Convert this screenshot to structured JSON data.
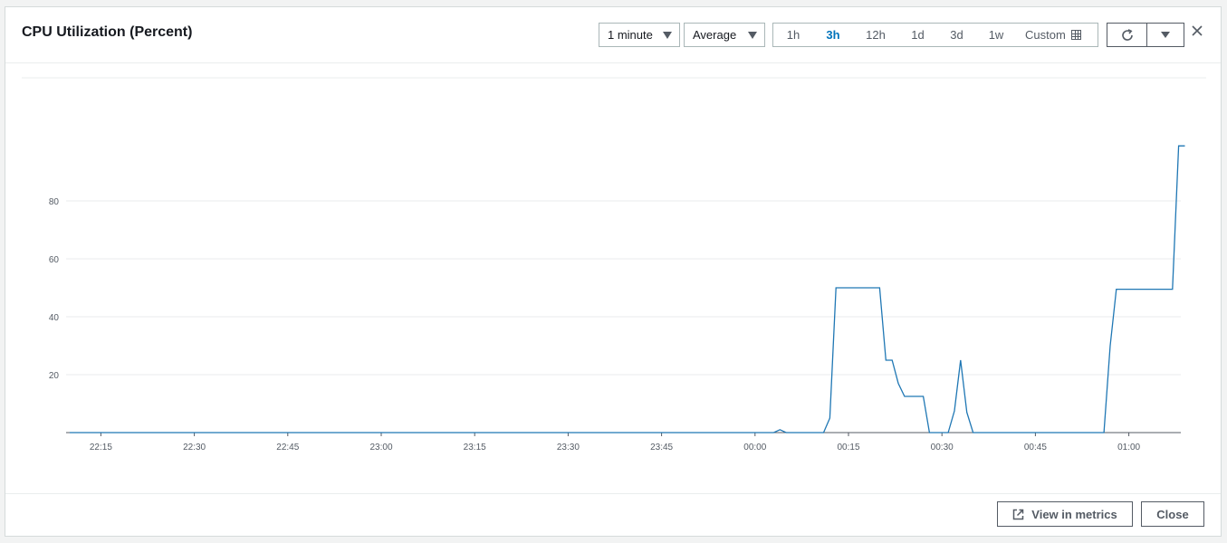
{
  "header": {
    "title": "CPU Utilization (Percent)",
    "period_select": "1 minute",
    "statistic_select": "Average",
    "time_ranges": [
      {
        "label": "1h",
        "active": false
      },
      {
        "label": "3h",
        "active": true
      },
      {
        "label": "12h",
        "active": false
      },
      {
        "label": "1d",
        "active": false
      },
      {
        "label": "3d",
        "active": false
      },
      {
        "label": "1w",
        "active": false
      }
    ],
    "custom_label": "Custom"
  },
  "footer": {
    "view_in_metrics": "View in metrics",
    "close": "Close"
  },
  "colors": {
    "series": "#1f77b4",
    "active_range": "#0073bb"
  },
  "icons": [
    "calendar-icon",
    "refresh-icon",
    "chevron-down-icon",
    "close-icon",
    "external-link-icon"
  ],
  "chart_data": {
    "type": "line",
    "title": "",
    "xlabel": "",
    "ylabel": "",
    "y_ticks": [
      "20",
      "40",
      "60",
      "80"
    ],
    "x_ticks": [
      "22:15",
      "22:30",
      "22:45",
      "23:00",
      "23:15",
      "23:30",
      "23:45",
      "00:00",
      "00:15",
      "00:30",
      "00:45",
      "01:00"
    ],
    "x_unit": "minutes from 22:10",
    "ylim": [
      0,
      100
    ],
    "grid": true,
    "series": [
      {
        "x": [
          0,
          113,
          114,
          115,
          116,
          117,
          118,
          119,
          120,
          121,
          122,
          123,
          124,
          125,
          126,
          127,
          128,
          129,
          130,
          131,
          132,
          133,
          134,
          135,
          136,
          137,
          138,
          139,
          140,
          141,
          142,
          143,
          144,
          145,
          146,
          147,
          148,
          149,
          150,
          151,
          152,
          153,
          154,
          155,
          156,
          157,
          158,
          159,
          160,
          161,
          162,
          163,
          164,
          165,
          166,
          167,
          168,
          169,
          170,
          171,
          172,
          173,
          174,
          175,
          176,
          177,
          178,
          179
        ],
        "values": [
          0,
          0,
          1,
          0,
          0,
          0,
          0,
          0,
          0,
          0,
          5,
          50,
          50,
          50,
          50,
          50,
          50,
          50,
          50,
          25,
          25,
          17,
          12.5,
          12.5,
          12.5,
          12.5,
          0,
          0,
          0,
          0,
          7.5,
          25,
          7,
          0,
          0,
          0,
          0,
          0,
          0,
          0,
          0,
          0,
          0,
          0,
          0,
          0,
          0,
          0,
          0,
          0,
          0,
          0,
          0,
          0,
          0,
          30,
          49.5,
          49.5,
          49.5,
          49.5,
          49.5,
          49.5,
          49.5,
          49.5,
          49.5,
          49.5,
          99,
          99
        ]
      }
    ]
  }
}
